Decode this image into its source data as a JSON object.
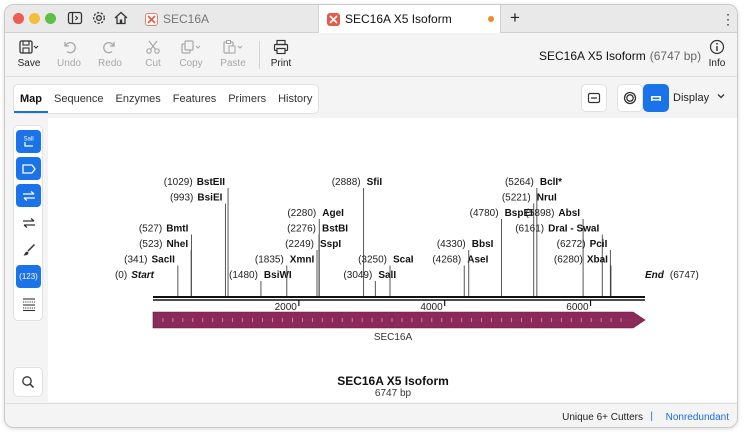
{
  "tabs": [
    {
      "label": "SEC16A",
      "active": false
    },
    {
      "label": "SEC16A X5 Isoform",
      "active": true
    }
  ],
  "toolbar": {
    "save": "Save",
    "undo": "Undo",
    "redo": "Redo",
    "cut": "Cut",
    "copy": "Copy",
    "paste": "Paste",
    "print": "Print",
    "info": "Info"
  },
  "document": {
    "name": "SEC16A X5 Isoform",
    "length": "(6747 bp)"
  },
  "view_tabs": [
    "Map",
    "Sequence",
    "Enzymes",
    "Features",
    "Primers",
    "History"
  ],
  "display_label": "Display",
  "side_tools": {
    "orf_label": "SalI",
    "numbers_label": "(123)"
  },
  "map": {
    "title": "SEC16A X5 Isoform",
    "subtitle": "6747 bp",
    "total_bp": 6747,
    "ticks": [
      {
        "pos": 2000,
        "label": "2000"
      },
      {
        "pos": 4000,
        "label": "4000"
      },
      {
        "pos": 6000,
        "label": "6000"
      }
    ],
    "feature": {
      "name": "SEC16A",
      "start": 1,
      "end": 6747,
      "color": "#8d2a5c"
    },
    "sites": [
      {
        "pos": 0,
        "num": "(0)",
        "name": "Start",
        "side": "left",
        "row": 0,
        "terminal": true
      },
      {
        "pos": 341,
        "num": "(341)",
        "name": "SacII",
        "side": "left",
        "row": 1
      },
      {
        "pos": 523,
        "num": "(523)",
        "name": "NheI",
        "side": "left",
        "row": 2
      },
      {
        "pos": 527,
        "num": "(527)",
        "name": "BmtI",
        "side": "left",
        "row": 3
      },
      {
        "pos": 993,
        "num": "(993)",
        "name": "BsiEI",
        "side": "left",
        "row": 5
      },
      {
        "pos": 1029,
        "num": "(1029)",
        "name": "BstEII",
        "side": "left",
        "row": 6
      },
      {
        "pos": 1480,
        "num": "(1480)",
        "name": "BsiWI",
        "side": "right",
        "row": 0
      },
      {
        "pos": 1835,
        "num": "(1835)",
        "name": "XmnI",
        "side": "right",
        "row": 1
      },
      {
        "pos": 2249,
        "num": "(2249)",
        "name": "SspI",
        "side": "right",
        "row": 2
      },
      {
        "pos": 2276,
        "num": "(2276)",
        "name": "BstBI",
        "side": "right",
        "row": 3
      },
      {
        "pos": 2280,
        "num": "(2280)",
        "name": "AgeI",
        "side": "right",
        "row": 4
      },
      {
        "pos": 2888,
        "num": "(2888)",
        "name": "SfiI",
        "side": "right",
        "row": 6
      },
      {
        "pos": 3049,
        "num": "(3049)",
        "name": "SalI",
        "side": "right",
        "row": 0
      },
      {
        "pos": 3250,
        "num": "(3250)",
        "name": "ScaI",
        "side": "right",
        "row": 1
      },
      {
        "pos": 4268,
        "num": "(4268)",
        "name": "AseI",
        "side": "right",
        "row": 1
      },
      {
        "pos": 4330,
        "num": "(4330)",
        "name": "BbsI",
        "side": "right",
        "row": 2
      },
      {
        "pos": 4780,
        "num": "(4780)",
        "name": "BspEI",
        "side": "right",
        "row": 4
      },
      {
        "pos": 5221,
        "num": "(5221)",
        "name": "NruI",
        "side": "right",
        "row": 5
      },
      {
        "pos": 5264,
        "num": "(5264)",
        "name": "BclI*",
        "side": "right",
        "row": 6
      },
      {
        "pos": 5898,
        "num": "(5898)",
        "name": "AbsI",
        "side": "left",
        "row": 4
      },
      {
        "pos": 6161,
        "num": "(6161)",
        "name": "DraI - SwaI",
        "side": "left",
        "row": 3
      },
      {
        "pos": 6272,
        "num": "(6272)",
        "name": "PciI",
        "side": "left",
        "row": 2
      },
      {
        "pos": 6280,
        "num": "(6280)",
        "name": "XbaI",
        "side": "left",
        "row": 1
      },
      {
        "pos": 6747,
        "num": "(6747)",
        "name": "End",
        "side": "left",
        "row": 0,
        "terminal": true
      }
    ]
  },
  "status": {
    "cutters": "Unique 6+ Cutters",
    "separator": "|",
    "mode": "Nonredundant"
  }
}
